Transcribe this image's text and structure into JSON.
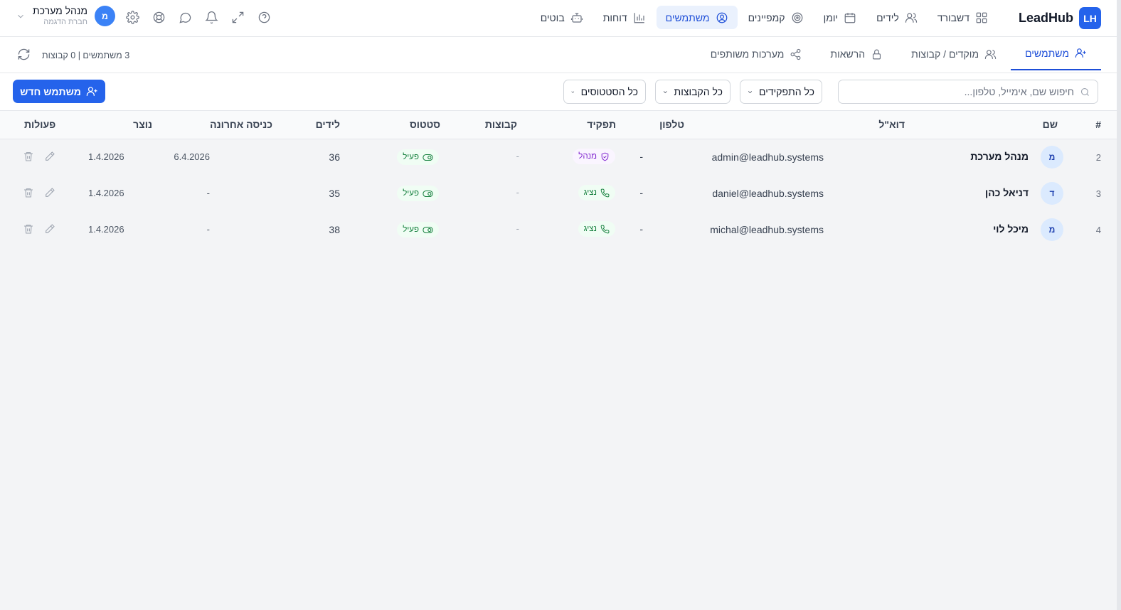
{
  "brand": {
    "logo": "LH",
    "name": "LeadHub"
  },
  "nav": [
    {
      "label": "דשבורד",
      "icon": "dashboard-icon",
      "active": false
    },
    {
      "label": "לידים",
      "icon": "users-icon",
      "active": false
    },
    {
      "label": "יומן",
      "icon": "calendar-icon",
      "active": false
    },
    {
      "label": "קמפיינים",
      "icon": "target-icon",
      "active": false
    },
    {
      "label": "משתמשים",
      "icon": "user-circle-icon",
      "active": true
    },
    {
      "label": "דוחות",
      "icon": "bar-chart-icon",
      "active": false
    },
    {
      "label": "בוטים",
      "icon": "bot-icon",
      "active": false
    }
  ],
  "tools": [
    "help-icon",
    "expand-icon",
    "bell-icon",
    "chat-icon",
    "support-icon",
    "gear-icon"
  ],
  "user": {
    "name": "מנהל מערכת",
    "org": "חברת הדגמה",
    "initial": "מ"
  },
  "subtabs": [
    {
      "label": "משתמשים",
      "icon": "user-plus-icon",
      "active": true
    },
    {
      "label": "מוקדים / קבוצות",
      "icon": "users-icon",
      "active": false
    },
    {
      "label": "הרשאות",
      "icon": "lock-icon",
      "active": false
    },
    {
      "label": "מערכות משותפים",
      "icon": "share-icon",
      "active": false
    }
  ],
  "summary": "3 משתמשים | 0 קבוצות",
  "filters": {
    "search_placeholder": "חיפוש שם, אימייל, טלפון...",
    "roles": "כל התפקידים",
    "groups": "כל הקבוצות",
    "statuses": "כל הסטטוסים",
    "new_user": "משתמש חדש"
  },
  "table": {
    "headers": {
      "num": "#",
      "name": "שם",
      "email": "דוא\"ל",
      "phone": "טלפון",
      "role": "תפקיד",
      "groups": "קבוצות",
      "status": "סטטוס",
      "leads": "לידים",
      "last_login": "כניסה אחרונה",
      "created": "נוצר",
      "actions": "פעולות"
    },
    "rows": [
      {
        "num": "2",
        "initial": "מ",
        "name": "מנהל מערכת",
        "email": "admin@leadhub.systems",
        "phone": "-",
        "role": "מנהל",
        "role_type": "admin",
        "groups": "-",
        "status": "פעיל",
        "leads": "36",
        "last_login": "6.4.2026",
        "created": "1.4.2026"
      },
      {
        "num": "3",
        "initial": "ד",
        "name": "דניאל כהן",
        "email": "daniel@leadhub.systems",
        "phone": "-",
        "role": "נציג",
        "role_type": "agent",
        "groups": "-",
        "status": "פעיל",
        "leads": "35",
        "last_login": "-",
        "created": "1.4.2026"
      },
      {
        "num": "4",
        "initial": "מ",
        "name": "מיכל לוי",
        "email": "michal@leadhub.systems",
        "phone": "-",
        "role": "נציג",
        "role_type": "agent",
        "groups": "-",
        "status": "פעיל",
        "leads": "38",
        "last_login": "-",
        "created": "1.4.2026"
      }
    ]
  },
  "colors": {
    "primary": "#2563eb",
    "active_bg": "#eaf1fd",
    "admin": "#7e22ce",
    "success": "#15803d"
  }
}
